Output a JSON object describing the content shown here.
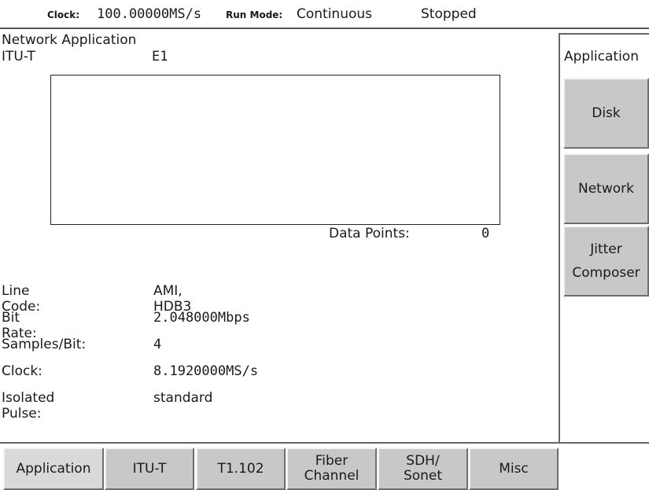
{
  "status": {
    "clock_label": "Clock:",
    "clock_value": "100.00000MS/s",
    "run_mode_label": "Run Mode:",
    "run_mode_value": "Continuous",
    "state": "Stopped"
  },
  "main": {
    "title": "Network Application",
    "standard": "ITU-T",
    "standard_value": "E1",
    "data_points_label": "Data Points:",
    "data_points_value": "0",
    "params": [
      {
        "label": "Line Code:",
        "value": "AMI, HDB3"
      },
      {
        "label": "Bit Rate:",
        "value": "2.048000Mbps"
      },
      {
        "label": "Samples/Bit:",
        "value": "4"
      },
      {
        "label": "Clock:",
        "value": "8.1920000MS/s"
      },
      {
        "label": "Isolated Pulse:",
        "value": "standard"
      }
    ]
  },
  "side": {
    "title": "Application",
    "buttons": [
      {
        "label": "Disk"
      },
      {
        "label": "Network"
      },
      {
        "label_line1": "Jitter",
        "label_line2": "Composer"
      }
    ]
  },
  "tabs": [
    {
      "label": "Application"
    },
    {
      "label": "ITU-T"
    },
    {
      "label": "T1.102"
    },
    {
      "label_line1": "Fiber",
      "label_line2": "Channel"
    },
    {
      "label_line1": "SDH/",
      "label_line2": "Sonet"
    },
    {
      "label": "Misc"
    }
  ]
}
